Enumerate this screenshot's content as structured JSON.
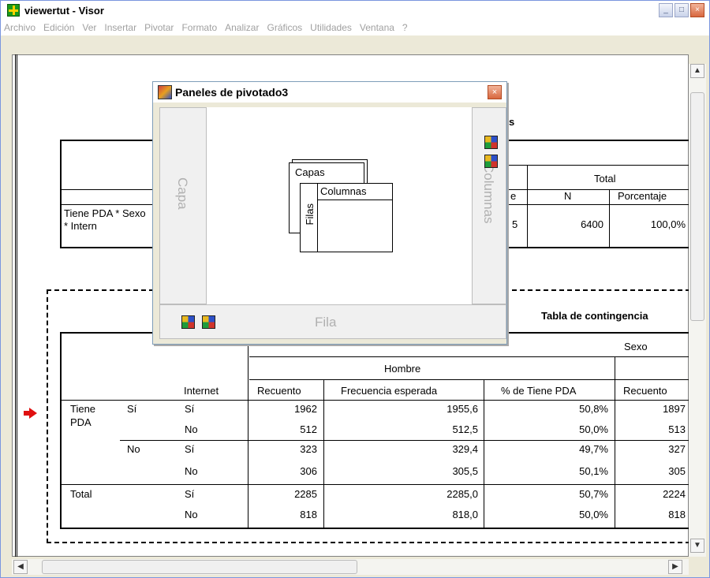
{
  "window": {
    "title": "viewertut - Visor"
  },
  "menu": [
    "Archivo",
    "Edición",
    "Ver",
    "Insertar",
    "Pivotar",
    "Formato",
    "Analizar",
    "Gráficos",
    "Utilidades",
    "Ventana",
    "?"
  ],
  "window_buttons": {
    "minimize": "_",
    "maximize": "□",
    "close": "×"
  },
  "summary_table": {
    "header_fragment": "s",
    "total_header": "Total",
    "col_fragment": "e",
    "n_header": "N",
    "pct_header": "Porcentaje",
    "row_label": "Tiene PDA * Sexo * Intern",
    "val_fragment": "5",
    "n_value": "6400",
    "pct_value": "100,0%"
  },
  "crosstab": {
    "title": "Tabla de contingencia",
    "sexo": "Sexo",
    "hombre": "Hombre",
    "internet": "Internet",
    "col_headers": [
      "Recuento",
      "Frecuencia esperada",
      "% de Tiene PDA",
      "Recuento"
    ],
    "row_label_a": "Tiene",
    "row_label_b": "PDA",
    "total_label": "Total",
    "groups": [
      {
        "label": "Sí",
        "rows": [
          {
            "internet": "Sí",
            "values": [
              "1962",
              "1955,6",
              "50,8%",
              "1897"
            ]
          },
          {
            "internet": "No",
            "values": [
              "512",
              "512,5",
              "50,0%",
              "513"
            ]
          }
        ]
      },
      {
        "label": "No",
        "rows": [
          {
            "internet": "Sí",
            "values": [
              "323",
              "329,4",
              "49,7%",
              "327"
            ]
          },
          {
            "internet": "No",
            "values": [
              "306",
              "305,5",
              "50,1%",
              "305"
            ]
          }
        ]
      }
    ],
    "total_rows": [
      {
        "internet": "Sí",
        "values": [
          "2285",
          "2285,0",
          "50,7%",
          "2224"
        ]
      },
      {
        "internet": "No",
        "values": [
          "818",
          "818,0",
          "50,0%",
          "818"
        ]
      }
    ]
  },
  "pivot_dialog": {
    "title": "Paneles de pivotado3",
    "layer_tray": "Capa",
    "column_tray": "Columnas",
    "row_tray": "Fila",
    "diagram": {
      "layers": "Capas",
      "columns": "Columnas",
      "rows": "Filas"
    },
    "close": "×"
  },
  "scroll": {
    "up": "▲",
    "down": "▼",
    "left": "◀",
    "right": "▶"
  },
  "colors": {
    "accent_arrow": "#e01010",
    "pivot_icon": [
      "#2d50c8",
      "#d0342c",
      "#1e9c3a",
      "#e8b820"
    ]
  }
}
